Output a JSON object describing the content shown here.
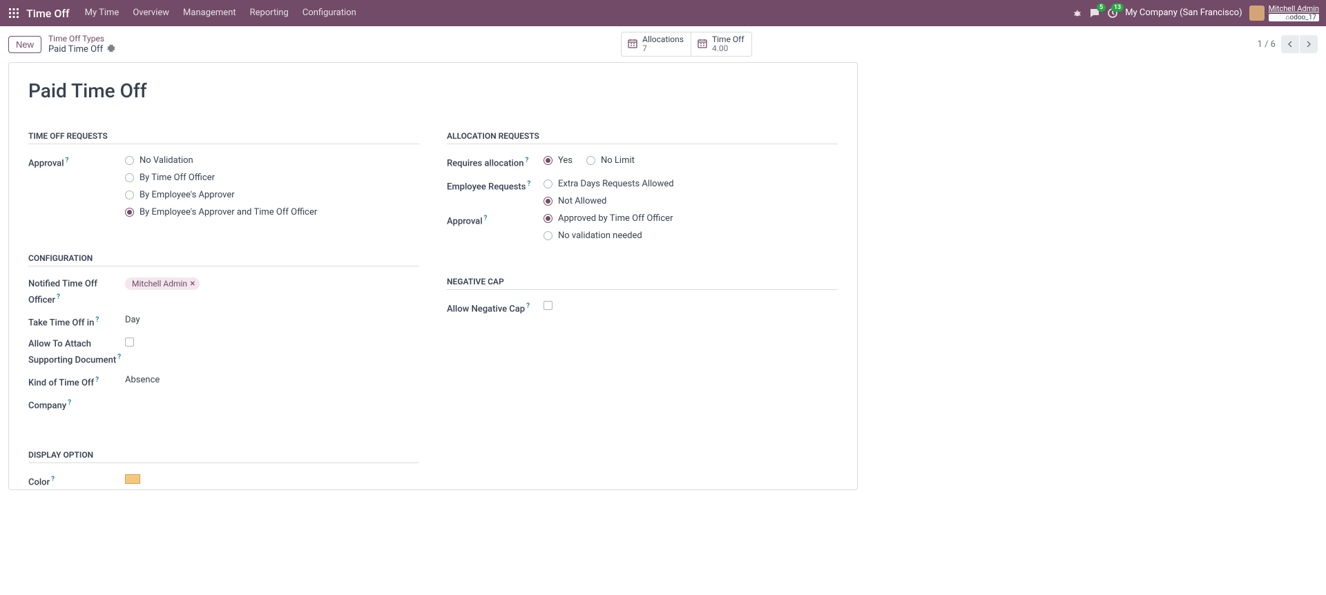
{
  "nav": {
    "brand": "Time Off",
    "items": [
      "My Time",
      "Overview",
      "Management",
      "Reporting",
      "Configuration"
    ],
    "msg_badge": "5",
    "activity_badge": "13",
    "company": "My Company (San Francisco)",
    "user_name": "Mitchell Admin",
    "user_db": "odoo_17"
  },
  "cp": {
    "new_btn": "New",
    "bc_parent": "Time Off Types",
    "bc_current": "Paid Time Off",
    "stat_alloc_label": "Allocations",
    "stat_alloc_val": "7",
    "stat_to_label": "Time Off",
    "stat_to_val": "4.00",
    "pager": "1 / 6"
  },
  "form": {
    "title": "Paid Time Off",
    "sec_requests": "TIME OFF REQUESTS",
    "sec_alloc": "ALLOCATION REQUESTS",
    "sec_config": "CONFIGURATION",
    "sec_neg": "NEGATIVE CAP",
    "sec_display": "DISPLAY OPTION",
    "lbl_approval": "Approval",
    "approval_opts": [
      "No Validation",
      "By Time Off Officer",
      "By Employee's Approver",
      "By Employee's Approver and Time Off Officer"
    ],
    "approval_selected": 3,
    "lbl_requires": "Requires allocation",
    "requires_opts": [
      "Yes",
      "No Limit"
    ],
    "requires_selected": 0,
    "lbl_emp_req": "Employee Requests",
    "emp_req_opts": [
      "Extra Days Requests Allowed",
      "Not Allowed"
    ],
    "emp_req_selected": 1,
    "lbl_alloc_approval": "Approval",
    "alloc_approval_opts": [
      "Approved by Time Off Officer",
      "No validation needed"
    ],
    "alloc_approval_selected": 0,
    "lbl_notified": "Notified Time Off Officer",
    "notified_tag": "Mitchell Admin",
    "lbl_take": "Take Time Off in",
    "take_val": "Day",
    "lbl_attach": "Allow To Attach Supporting Document",
    "lbl_kind": "Kind of Time Off",
    "kind_val": "Absence",
    "lbl_company": "Company",
    "lbl_neg": "Allow Negative Cap",
    "lbl_color": "Color"
  }
}
